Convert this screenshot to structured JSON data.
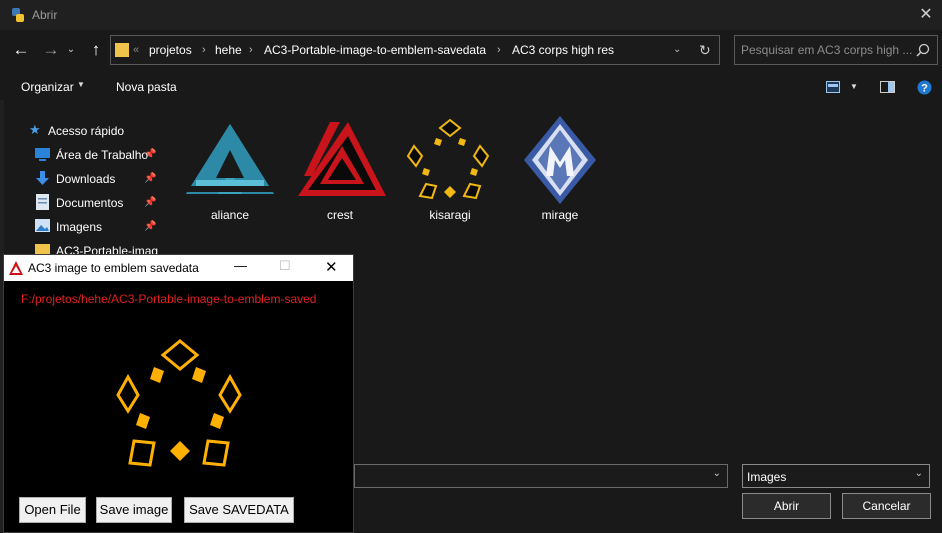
{
  "window": {
    "title": "Abrir"
  },
  "address": {
    "overflow": "«",
    "crumbs": [
      "projetos",
      "hehe",
      "AC3-Portable-image-to-emblem-savedata",
      "AC3 corps high res"
    ]
  },
  "search": {
    "placeholder": "Pesquisar em AC3 corps high ..."
  },
  "toolbar": {
    "organize": "Organizar",
    "new_folder": "Nova pasta"
  },
  "sidebar": {
    "quick_access": "Acesso rápido",
    "items": [
      {
        "label": "Área de Trabalho",
        "icon": "desktop-icon"
      },
      {
        "label": "Downloads",
        "icon": "download-icon"
      },
      {
        "label": "Documentos",
        "icon": "document-icon"
      },
      {
        "label": "Imagens",
        "icon": "images-icon"
      },
      {
        "label": "AC3-Portable-imag",
        "icon": "folder-icon"
      }
    ]
  },
  "files": [
    {
      "name": "aliance"
    },
    {
      "name": "crest"
    },
    {
      "name": "kisaragi"
    },
    {
      "name": "mirage"
    }
  ],
  "bottom": {
    "filter": "Images",
    "open": "Abrir",
    "cancel": "Cancelar"
  },
  "popup": {
    "title": "AC3 image to emblem savedata",
    "path": "F:/projetos/hehe/AC3-Portable-image-to-emblem-saved",
    "buttons": {
      "open": "Open File",
      "save_image": "Save image",
      "save_savedata": "Save SAVEDATA"
    }
  },
  "colors": {
    "accent": "#ffb000",
    "path_red": "#e0211f",
    "crest_red": "#c8141a",
    "aliance_teal": "#3aa4bf",
    "mirage_blue": "#3a5aa5"
  }
}
